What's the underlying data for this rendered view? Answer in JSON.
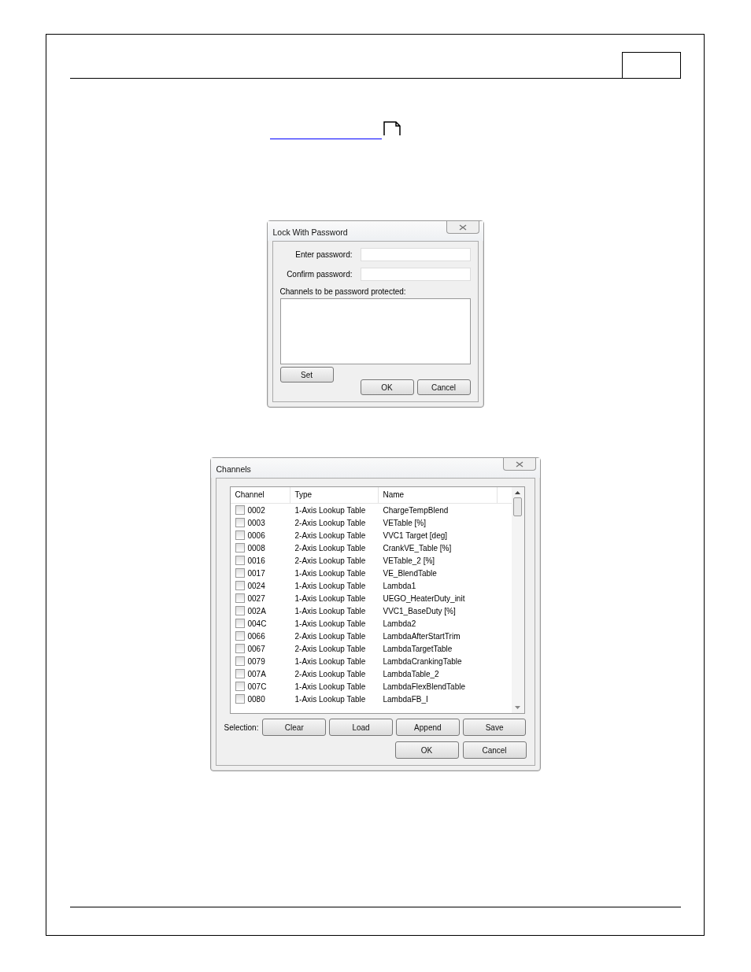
{
  "lock_dialog": {
    "title": "Lock With Password",
    "fields": [
      {
        "label": "Enter password:"
      },
      {
        "label": "Confirm password:"
      }
    ],
    "channels_label": "Channels to be password protected:",
    "set_button": "Set",
    "buttons": [
      "OK",
      "Cancel"
    ]
  },
  "channels_dialog": {
    "title": "Channels",
    "columns": [
      "Channel",
      "Type",
      "Name"
    ],
    "rows": [
      {
        "channel": "0002",
        "type": "1-Axis Lookup Table",
        "name": "ChargeTempBlend",
        "checked": false
      },
      {
        "channel": "0003",
        "type": "2-Axis Lookup Table",
        "name": "VETable [%]",
        "checked": false
      },
      {
        "channel": "0006",
        "type": "2-Axis Lookup Table",
        "name": "VVC1 Target [deg]",
        "checked": false
      },
      {
        "channel": "0008",
        "type": "2-Axis Lookup Table",
        "name": "CrankVE_Table [%]",
        "checked": false
      },
      {
        "channel": "0016",
        "type": "2-Axis Lookup Table",
        "name": "VETable_2 [%]",
        "checked": false
      },
      {
        "channel": "0017",
        "type": "1-Axis Lookup Table",
        "name": "VE_BlendTable",
        "checked": false
      },
      {
        "channel": "0024",
        "type": "1-Axis Lookup Table",
        "name": "Lambda1",
        "checked": false
      },
      {
        "channel": "0027",
        "type": "1-Axis Lookup Table",
        "name": "UEGO_HeaterDuty_init",
        "checked": false
      },
      {
        "channel": "002A",
        "type": "1-Axis Lookup Table",
        "name": "VVC1_BaseDuty [%]",
        "checked": false
      },
      {
        "channel": "004C",
        "type": "1-Axis Lookup Table",
        "name": "Lambda2",
        "checked": false
      },
      {
        "channel": "0066",
        "type": "2-Axis Lookup Table",
        "name": "LambdaAfterStartTrim",
        "checked": false
      },
      {
        "channel": "0067",
        "type": "2-Axis Lookup Table",
        "name": "LambdaTargetTable",
        "checked": false
      },
      {
        "channel": "0079",
        "type": "1-Axis Lookup Table",
        "name": "LambdaCrankingTable",
        "checked": false
      },
      {
        "channel": "007A",
        "type": "2-Axis Lookup Table",
        "name": "LambdaTable_2",
        "checked": false
      },
      {
        "channel": "007C",
        "type": "1-Axis Lookup Table",
        "name": "LambdaFlexBlendTable",
        "checked": false
      },
      {
        "channel": "0080",
        "type": "1-Axis Lookup Table",
        "name": "LambdaFB_I",
        "checked": false
      }
    ],
    "selection_label": "Selection:",
    "selection_buttons": [
      "Clear",
      "Load",
      "Append",
      "Save"
    ],
    "buttons": [
      "OK",
      "Cancel"
    ]
  }
}
